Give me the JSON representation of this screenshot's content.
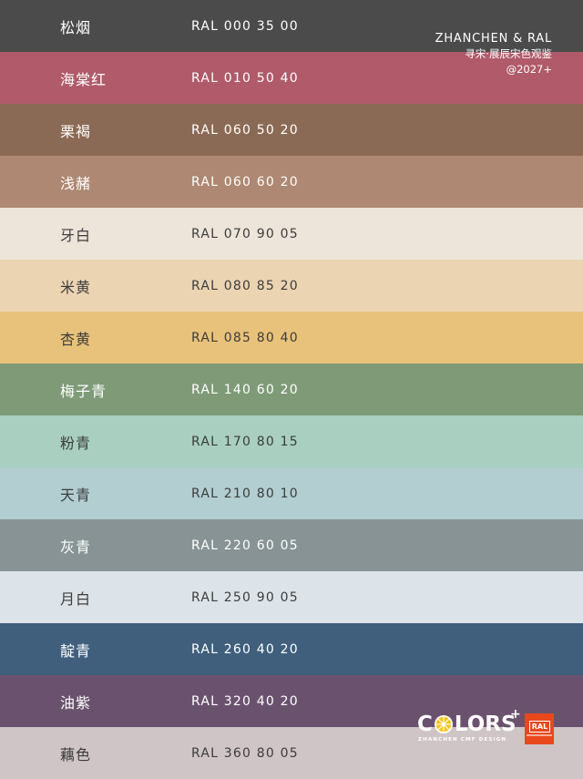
{
  "swatches": [
    {
      "name": "松烟",
      "code": "RAL 000 35 00",
      "bg": "#4b4b4b",
      "fg": "#ffffff"
    },
    {
      "name": "海棠红",
      "code": "RAL 010 50 40",
      "bg": "#b05a6a",
      "fg": "#ffffff"
    },
    {
      "name": "栗褐",
      "code": "RAL 060 50 20",
      "bg": "#8b6a55",
      "fg": "#ffffff"
    },
    {
      "name": "浅赭",
      "code": "RAL 060 60 20",
      "bg": "#ae8872",
      "fg": "#ffffff"
    },
    {
      "name": "牙白",
      "code": "RAL 070 90 05",
      "bg": "#ede4da",
      "fg": "#3c3c3c"
    },
    {
      "name": "米黄",
      "code": "RAL 080 85 20",
      "bg": "#ebd4b2",
      "fg": "#3c3c3c"
    },
    {
      "name": "杏黄",
      "code": "RAL 085 80 40",
      "bg": "#e8c27a",
      "fg": "#3c3c3c"
    },
    {
      "name": "梅子青",
      "code": "RAL 140 60 20",
      "bg": "#7e9a77",
      "fg": "#ffffff"
    },
    {
      "name": "粉青",
      "code": "RAL 170 80 15",
      "bg": "#a8cfbf",
      "fg": "#3c3c3c"
    },
    {
      "name": "天青",
      "code": "RAL 210 80 10",
      "bg": "#b2ced0",
      "fg": "#3c3c3c"
    },
    {
      "name": "灰青",
      "code": "RAL 220 60 05",
      "bg": "#879394",
      "fg": "#ffffff"
    },
    {
      "name": "月白",
      "code": "RAL 250 90 05",
      "bg": "#dde4e9",
      "fg": "#3c3c3c"
    },
    {
      "name": "靛青",
      "code": "RAL 260 40 20",
      "bg": "#3f5f7c",
      "fg": "#ffffff"
    },
    {
      "name": "油紫",
      "code": "RAL 320 40 20",
      "bg": "#6a526e",
      "fg": "#ffffff"
    },
    {
      "name": "藕色",
      "code": "RAL 360 80 05",
      "bg": "#cfc4c6",
      "fg": "#3c3c3c"
    }
  ],
  "brand": {
    "line1": "ZHANCHEN & RAL",
    "line2": "寻宋·展辰宋色观鉴",
    "line3": "@2027+"
  },
  "logo": {
    "word_left": "C",
    "word_right": "LORS",
    "plus": "+",
    "subtitle": "ZHANCHEN CMF DESIGN",
    "badge": "RAL",
    "sun_color": "#f5c518",
    "badge_color": "#e8481b"
  }
}
